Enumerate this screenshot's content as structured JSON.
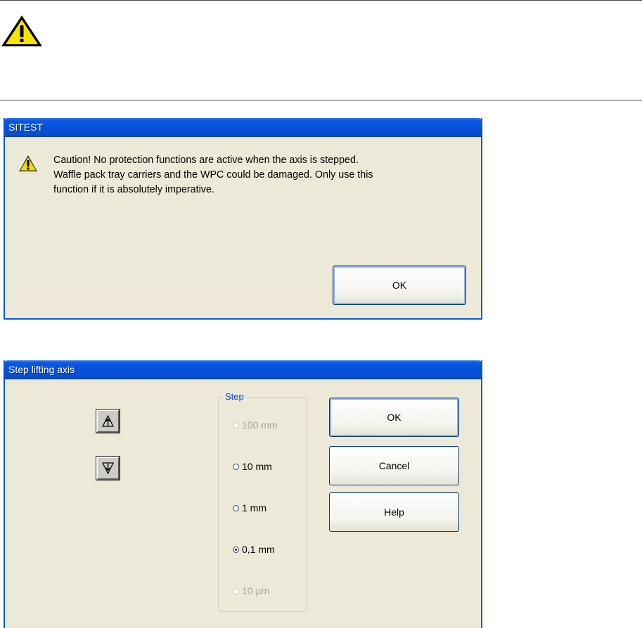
{
  "caution_dialog": {
    "title": "SITEST",
    "message_lines": [
      "Caution! No protection functions are active when the axis is stepped.",
      "Waffle pack tray carriers and the WPC could be damaged. Only use this",
      "function if it is absolutely imperative."
    ],
    "ok_label": "OK"
  },
  "step_dialog": {
    "title": "Step lifting axis",
    "up_icon": "arrow-up-icon",
    "down_icon": "arrow-down-icon",
    "group_label": "Step",
    "options": [
      {
        "label": "100 mm",
        "enabled": false,
        "selected": false
      },
      {
        "label": "10 mm",
        "enabled": true,
        "selected": false
      },
      {
        "label": "1 mm",
        "enabled": true,
        "selected": false
      },
      {
        "label": "0,1 mm",
        "enabled": true,
        "selected": true
      },
      {
        "label": "10 µm",
        "enabled": false,
        "selected": false
      }
    ],
    "ok_label": "OK",
    "cancel_label": "Cancel",
    "help_label": "Help"
  },
  "colors": {
    "title_bar": "#0550d8",
    "dialog_bg": "#ece9d8",
    "group_label": "#0046d5"
  }
}
